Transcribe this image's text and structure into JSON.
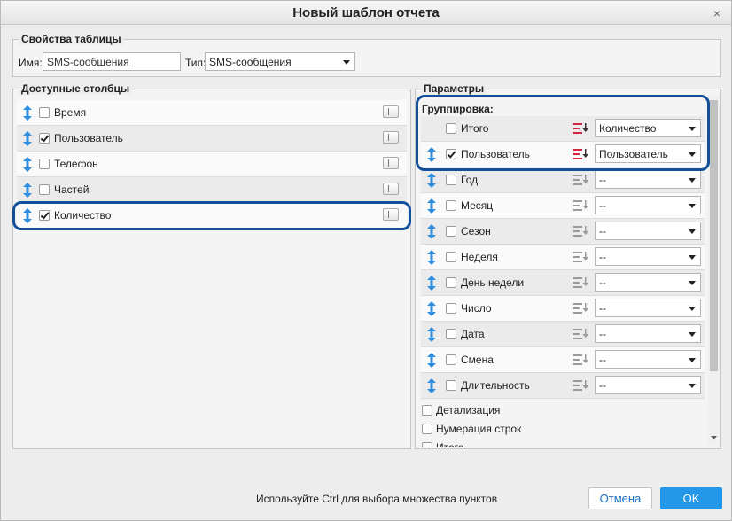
{
  "dialog": {
    "title": "Новый шаблон отчета",
    "close_label": "×"
  },
  "table_props": {
    "legend": "Свойства таблицы",
    "name_label": "Имя:",
    "name_value": "SMS-сообщения",
    "type_label": "Тип:",
    "type_value": "SMS-сообщения"
  },
  "available": {
    "legend": "Доступные столбцы",
    "items": [
      {
        "label": "Время",
        "checked": false
      },
      {
        "label": "Пользователь",
        "checked": true
      },
      {
        "label": "Телефон",
        "checked": false
      },
      {
        "label": "Частей",
        "checked": false
      },
      {
        "label": "Количество",
        "checked": true
      }
    ]
  },
  "params": {
    "legend": "Параметры",
    "grouping_label": "Группировка:",
    "groups": [
      {
        "label": "Итого",
        "checked": false,
        "select": "Количество",
        "draggable": false,
        "sort_active": true
      },
      {
        "label": "Пользователь",
        "checked": true,
        "select": "Пользователь",
        "draggable": true,
        "sort_active": true
      },
      {
        "label": "Год",
        "checked": false,
        "select": "--",
        "draggable": true,
        "sort_active": false
      },
      {
        "label": "Месяц",
        "checked": false,
        "select": "--",
        "draggable": true,
        "sort_active": false
      },
      {
        "label": "Сезон",
        "checked": false,
        "select": "--",
        "draggable": true,
        "sort_active": false
      },
      {
        "label": "Неделя",
        "checked": false,
        "select": "--",
        "draggable": true,
        "sort_active": false
      },
      {
        "label": "День недели",
        "checked": false,
        "select": "--",
        "draggable": true,
        "sort_active": false
      },
      {
        "label": "Число",
        "checked": false,
        "select": "--",
        "draggable": true,
        "sort_active": false
      },
      {
        "label": "Дата",
        "checked": false,
        "select": "--",
        "draggable": true,
        "sort_active": false
      },
      {
        "label": "Смена",
        "checked": false,
        "select": "--",
        "draggable": true,
        "sort_active": false
      },
      {
        "label": "Длительность",
        "checked": false,
        "select": "--",
        "draggable": true,
        "sort_active": false
      }
    ],
    "options": [
      {
        "label": "Детализация",
        "checked": false
      },
      {
        "label": "Нумерация строк",
        "checked": false
      },
      {
        "label": "Итого",
        "checked": false
      }
    ]
  },
  "footer": {
    "hint": "Используйте Ctrl для выбора множества пунктов",
    "cancel_label": "Отмена",
    "ok_label": "OK"
  },
  "colors": {
    "accent": "#2497e8",
    "highlight": "#134f9b",
    "sort_active": "#d4243d",
    "drag_icon": "#2e8fe0"
  }
}
